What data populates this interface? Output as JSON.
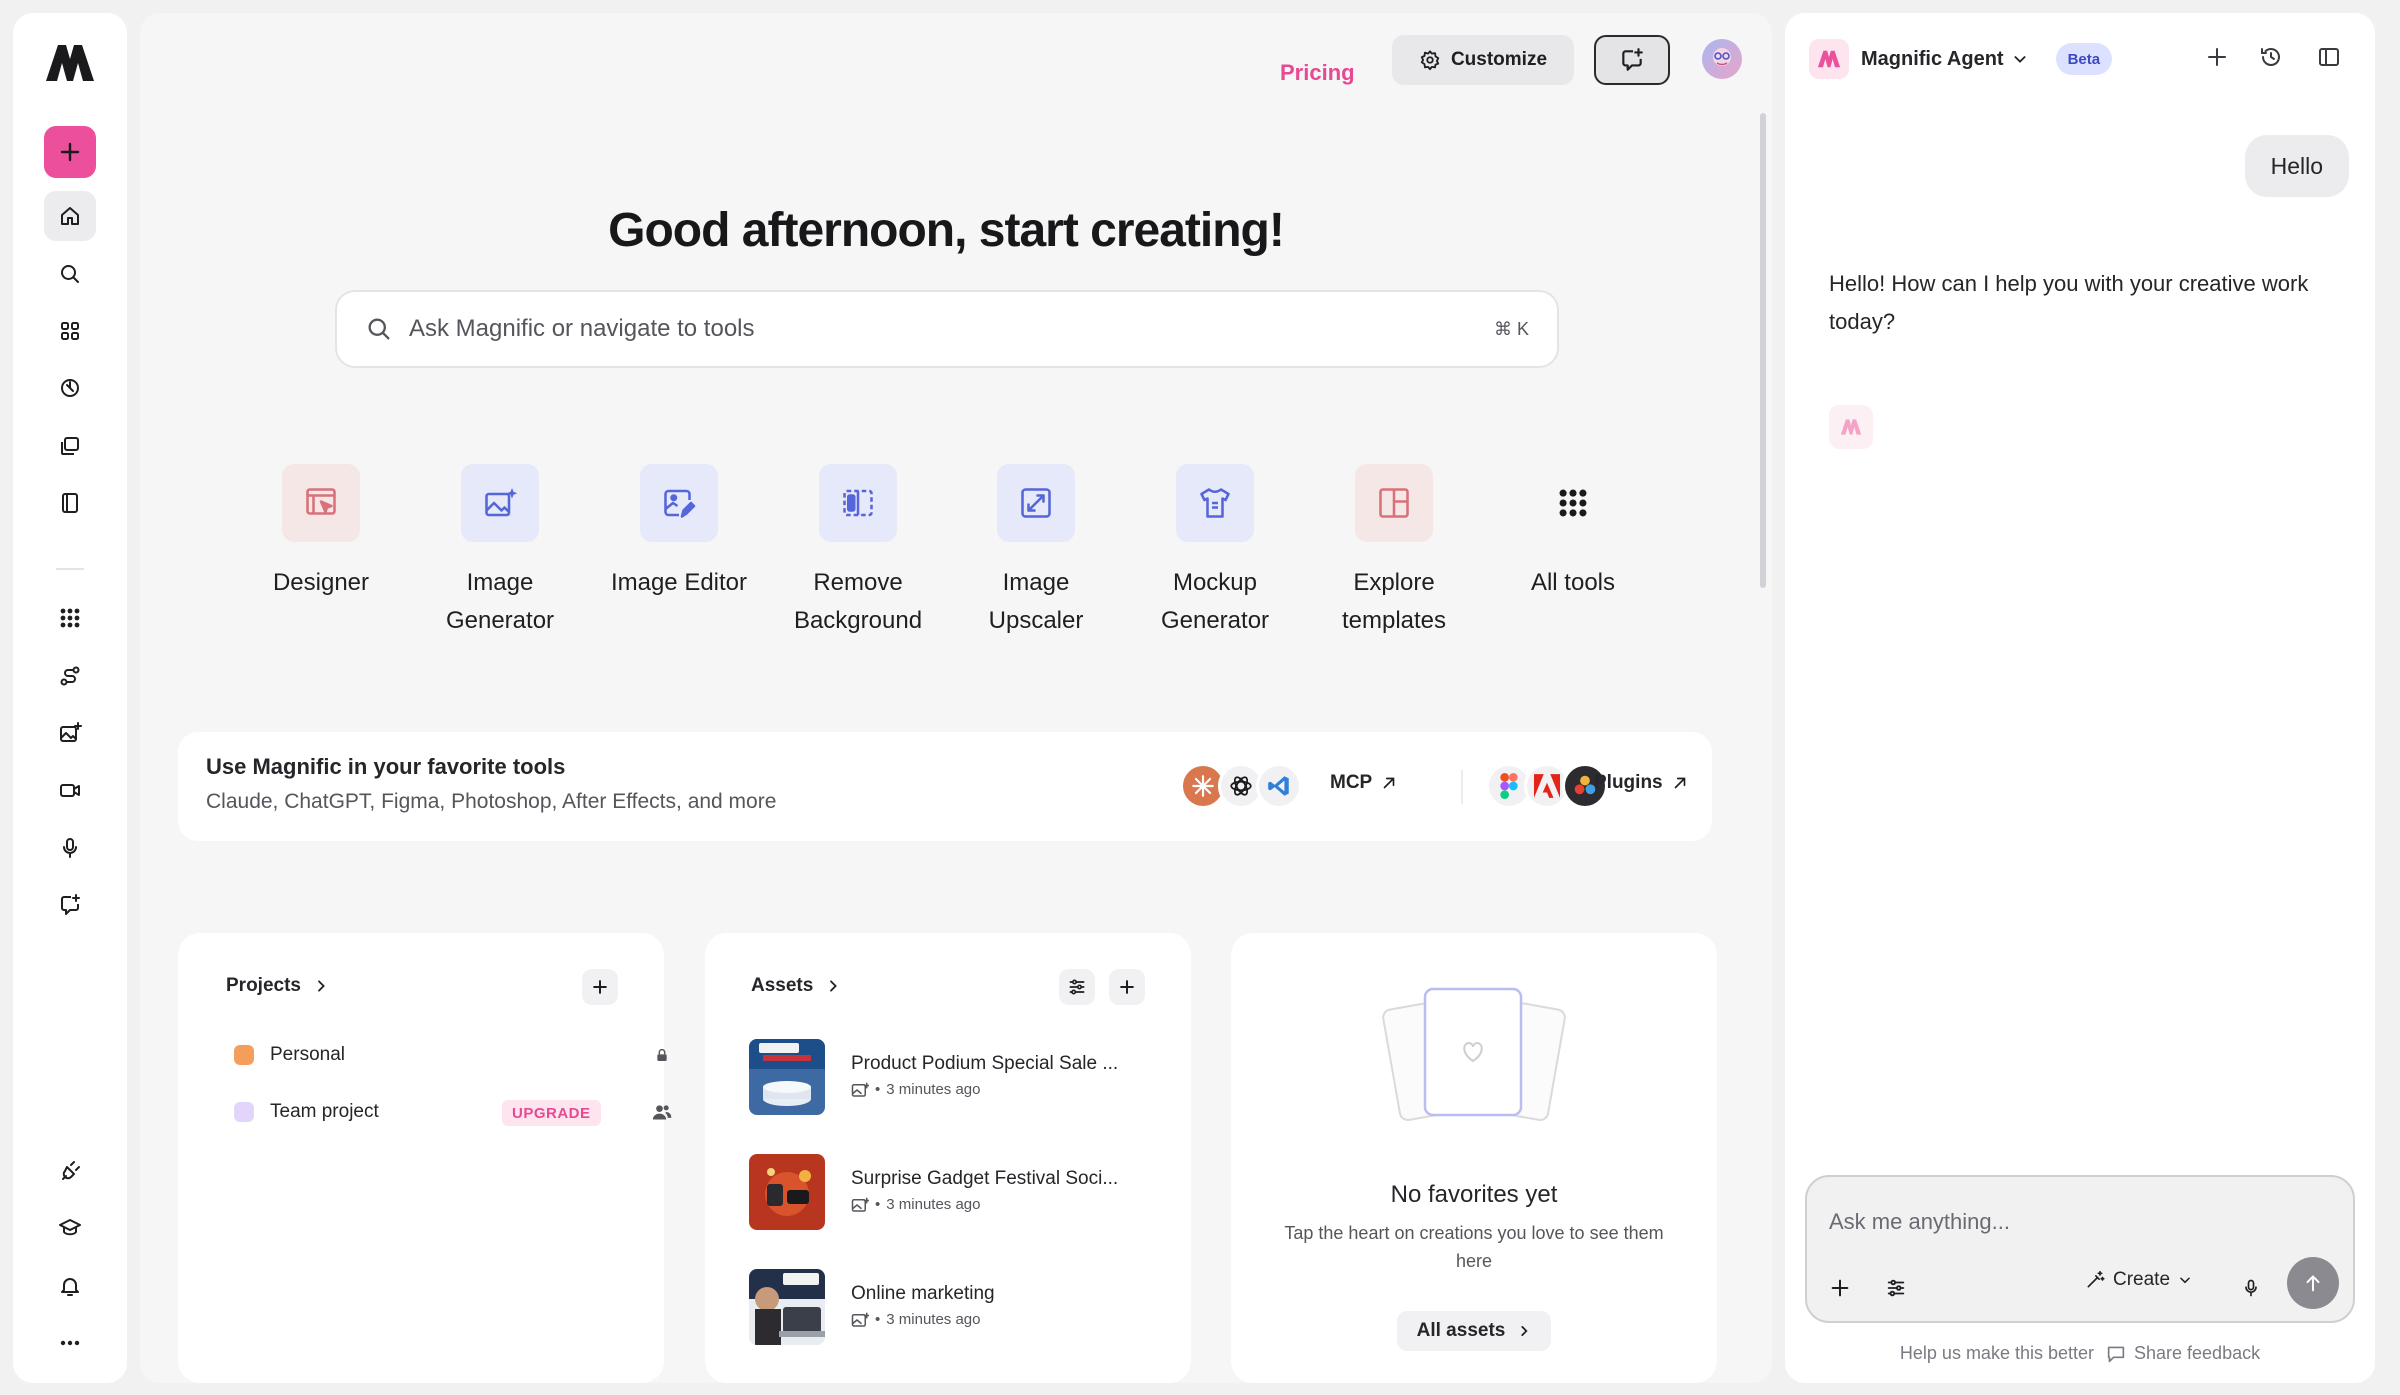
{
  "rail": {
    "logo": "magnific-logo",
    "new_button": "plus-icon",
    "items": [
      {
        "name": "home",
        "icon": "home-icon"
      },
      {
        "name": "search",
        "icon": "search-icon"
      },
      {
        "name": "apps",
        "icon": "grid-icon"
      },
      {
        "name": "history",
        "icon": "clock-icon"
      },
      {
        "name": "gallery",
        "icon": "images-icon"
      },
      {
        "name": "library",
        "icon": "book-icon"
      },
      {
        "name": "all-tools",
        "icon": "dots-grid-icon"
      },
      {
        "name": "workflows",
        "icon": "workflow-icon"
      },
      {
        "name": "image-generator",
        "icon": "image-plus-icon"
      },
      {
        "name": "video",
        "icon": "video-icon"
      },
      {
        "name": "audio",
        "icon": "microphone-icon"
      },
      {
        "name": "chat",
        "icon": "chat-spark-icon"
      },
      {
        "name": "plugins",
        "icon": "plug-icon"
      },
      {
        "name": "learn",
        "icon": "graduation-cap-icon"
      },
      {
        "name": "notifications",
        "icon": "bell-icon"
      },
      {
        "name": "more",
        "icon": "more-icon"
      }
    ]
  },
  "topbar": {
    "pricing": "Pricing",
    "customize": "Customize"
  },
  "hero": {
    "title": "Good afternoon, start creating!",
    "search_placeholder": "Ask Magnific or navigate to tools",
    "shortcut": "⌘ K"
  },
  "tools": [
    {
      "label": "Designer",
      "icon": "designer-icon"
    },
    {
      "label": "Image Generator",
      "icon": "image-spark-icon"
    },
    {
      "label": "Image Editor",
      "icon": "image-edit-icon"
    },
    {
      "label": "Remove Background",
      "icon": "remove-bg-icon"
    },
    {
      "label": "Image Upscaler",
      "icon": "upscale-icon"
    },
    {
      "label": "Mockup Generator",
      "icon": "shirt-icon"
    },
    {
      "label": "Explore templates",
      "icon": "templates-icon"
    },
    {
      "label": "All tools",
      "icon": "dots-grid-icon"
    }
  ],
  "integrations": {
    "title": "Use Magnific in your favorite tools",
    "subtitle": "Claude, ChatGPT, Figma, Photoshop, After Effects, and more",
    "mcp_label": "MCP",
    "plugins_label": "Plugins"
  },
  "projects": {
    "title": "Projects",
    "items": [
      {
        "name": "Personal",
        "color": "#f59e5b"
      },
      {
        "name": "Team project",
        "color": "#e3d4fb",
        "badge": "UPGRADE"
      }
    ]
  },
  "assets": {
    "title": "Assets",
    "items": [
      {
        "name": "Product Podium Special Sale ...",
        "time": "3 minutes ago"
      },
      {
        "name": "Surprise Gadget Festival Soci...",
        "time": "3 minutes ago"
      },
      {
        "name": "Online marketing",
        "time": "3 minutes ago"
      }
    ]
  },
  "favorites": {
    "empty_title": "No favorites yet",
    "empty_sub": "Tap the heart on creations you love to see them here",
    "button": "All assets"
  },
  "agent": {
    "name": "Magnific Agent",
    "badge": "Beta",
    "user_message": "Hello",
    "reply": "Hello! How can I help you with your creative work today?",
    "placeholder": "Ask me anything...",
    "create": "Create",
    "footer_hint": "Help us make this better",
    "footer_feedback": "Share feedback"
  },
  "colors": {
    "accent": "#ec4f9b",
    "beta_bg": "#dbe1ff",
    "tool_red_tile": "#f6e7e7",
    "tool_blue_tile": "#e6e9f9"
  }
}
